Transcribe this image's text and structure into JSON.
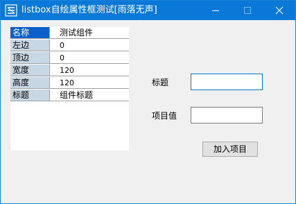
{
  "window": {
    "title": "listbox自绘属性框测试[雨落无声]",
    "titlebar_color": "#0a78d7"
  },
  "property_grid": {
    "rows": [
      {
        "key": "名称",
        "value": "测试组件",
        "selected": true
      },
      {
        "key": "左边",
        "value": "0"
      },
      {
        "key": "顶边",
        "value": "0"
      },
      {
        "key": "宽度",
        "value": "120"
      },
      {
        "key": "高度",
        "value": "120"
      },
      {
        "key": "标题",
        "value": "组件标题"
      }
    ],
    "key_bg": "#c8d7e4",
    "selected_bg": "#0a60c8"
  },
  "form": {
    "title_label": "标题",
    "title_value": "",
    "item_label": "项目值",
    "item_value": "",
    "add_button": "加入项目"
  }
}
